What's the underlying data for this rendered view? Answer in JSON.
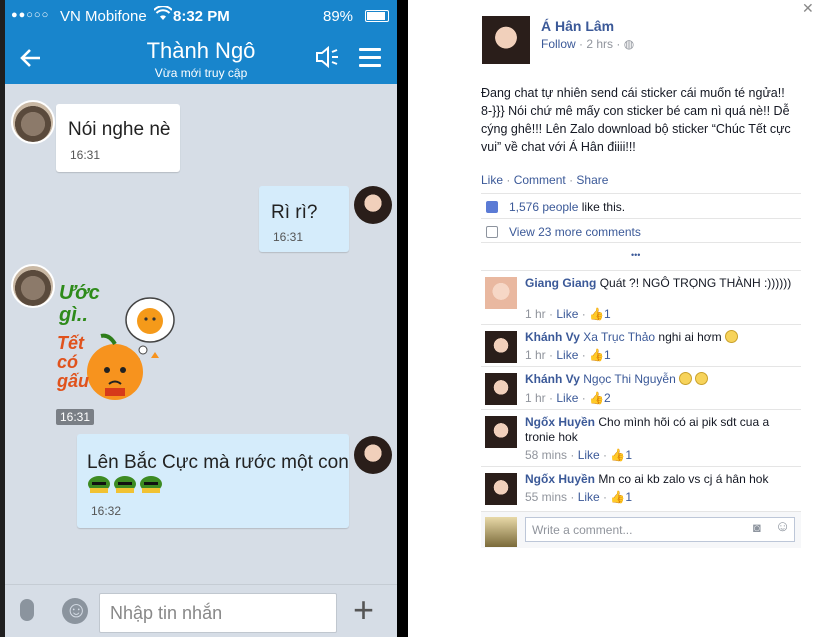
{
  "phone": {
    "status": {
      "signal": "●●○○○",
      "carrier": "VN Mobifone",
      "time": "8:32 PM",
      "battery": "89%"
    },
    "header": {
      "back_icon": "arrow-left-icon",
      "contact_name": "Thành Ngô",
      "subtitle": "Vừa mới truy cập"
    },
    "messages": [
      {
        "side": "in",
        "text": "Nói nghe nè",
        "time": "16:31"
      },
      {
        "side": "out",
        "text": "Rì rì?",
        "time": "16:31"
      },
      {
        "side": "in",
        "sticker": true,
        "sticker_text": [
          "Ước",
          "gì..",
          "Tết",
          "có",
          "gấu"
        ],
        "time": "16:31"
      },
      {
        "side": "out",
        "text": "Lên Bắc Cực mà rước một con",
        "time": "16:32"
      }
    ],
    "input": {
      "placeholder": "Nhập tin nhắn"
    }
  },
  "facebook": {
    "author": "Á Hân Lâm",
    "follow": "Follow",
    "timestamp": "2 hrs",
    "post_text": "Đang chat tự nhiên send cái sticker cái muốn té ngửa!! 8-}}} Nói chứ mê mấy con sticker bé cam nì quá nè!! Dễ cýng ghê!!! Lên Zalo download bộ sticker “Chúc Tết cực vui” về chat với Á Hân điiii!!!",
    "actions": {
      "like": "Like",
      "comment": "Comment",
      "share": "Share"
    },
    "likes": {
      "count": "1,576 people",
      "suffix": "like this."
    },
    "more_comments": "View 23 more comments",
    "ellipsis": "•••",
    "comments": [
      {
        "name": "Giang Giang",
        "text": "Quát ?! NGÔ TRỌNG THÀNH :))))))",
        "time": "1 hr",
        "likes": "1"
      },
      {
        "name": "Khánh Vy",
        "tag": "Xa Trục Thảo",
        "text": "nghi ai hơm",
        "time": "1 hr",
        "likes": "1"
      },
      {
        "name": "Khánh Vy",
        "tag": "Ngọc Thi Nguyễn",
        "text": "",
        "time": "1 hr",
        "likes": "2"
      },
      {
        "name": "Ngốx Huyền",
        "text": "Cho mình hõi có ai pik sdt cua a tronie hok",
        "time": "58 mins",
        "likes": "1"
      },
      {
        "name": "Ngốx Huyền",
        "text": "Mn co ai kb zalo vs cj á hân hok",
        "time": "55 mins",
        "likes": "1"
      }
    ],
    "comment_like_label": "Like",
    "write_placeholder": "Write a comment..."
  }
}
